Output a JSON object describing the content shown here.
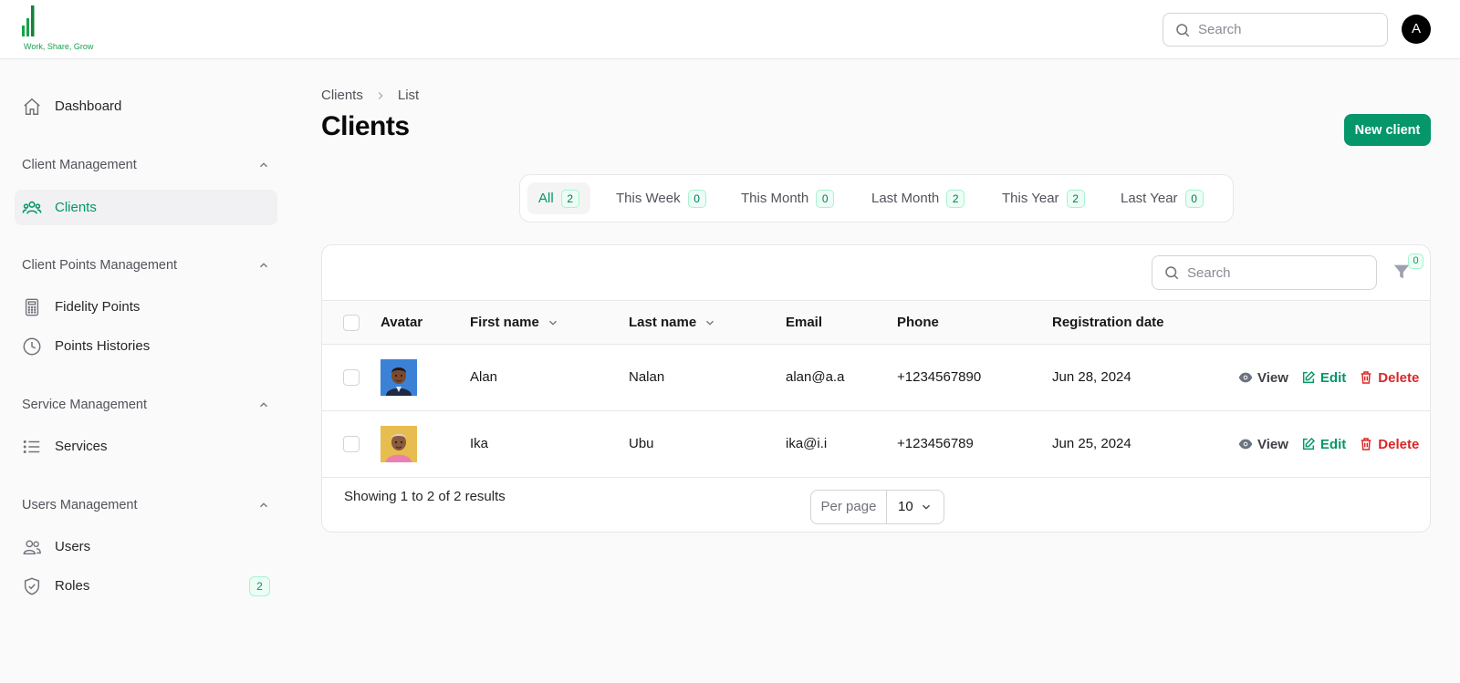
{
  "brand": {
    "tagline": "Work, Share, Grow",
    "accent": "#059669"
  },
  "header": {
    "search_placeholder": "Search",
    "user_initial": "A"
  },
  "sidebar": {
    "dashboard": {
      "label": "Dashboard",
      "icon": "home-icon"
    },
    "groups": [
      {
        "label": "Client Management",
        "items": [
          {
            "label": "Clients",
            "icon": "users-icon",
            "active": true
          }
        ]
      },
      {
        "label": "Client Points Management",
        "items": [
          {
            "label": "Fidelity Points",
            "icon": "calculator-icon"
          },
          {
            "label": "Points Histories",
            "icon": "clock-icon"
          }
        ]
      },
      {
        "label": "Service Management",
        "items": [
          {
            "label": "Services",
            "icon": "list-icon"
          }
        ]
      },
      {
        "label": "Users Management",
        "items": [
          {
            "label": "Users",
            "icon": "user-group-icon"
          },
          {
            "label": "Roles",
            "icon": "shield-icon",
            "badge": "2"
          }
        ]
      }
    ]
  },
  "breadcrumb": {
    "parent": "Clients",
    "current": "List"
  },
  "page": {
    "title": "Clients",
    "new_button": "New client"
  },
  "tabs": [
    {
      "label": "All",
      "count": "2",
      "active": true
    },
    {
      "label": "This Week",
      "count": "0"
    },
    {
      "label": "This Month",
      "count": "0"
    },
    {
      "label": "Last Month",
      "count": "2"
    },
    {
      "label": "This Year",
      "count": "2"
    },
    {
      "label": "Last Year",
      "count": "0"
    }
  ],
  "table": {
    "search_placeholder": "Search",
    "filter_count": "0",
    "columns": {
      "avatar": "Avatar",
      "first_name": "First name",
      "last_name": "Last name",
      "email": "Email",
      "phone": "Phone",
      "registration_date": "Registration date"
    },
    "rows": [
      {
        "first_name": "Alan",
        "last_name": "Nalan",
        "email": "alan@a.a",
        "phone": "+1234567890",
        "registration_date": "Jun 28, 2024"
      },
      {
        "first_name": "Ika",
        "last_name": "Ubu",
        "email": "ika@i.i",
        "phone": "+123456789",
        "registration_date": "Jun 25, 2024"
      }
    ],
    "actions": {
      "view": "View",
      "edit": "Edit",
      "delete": "Delete"
    },
    "footer": {
      "showing": "Showing 1 to 2 of 2 results",
      "per_page_label": "Per page",
      "per_page_value": "10"
    }
  }
}
